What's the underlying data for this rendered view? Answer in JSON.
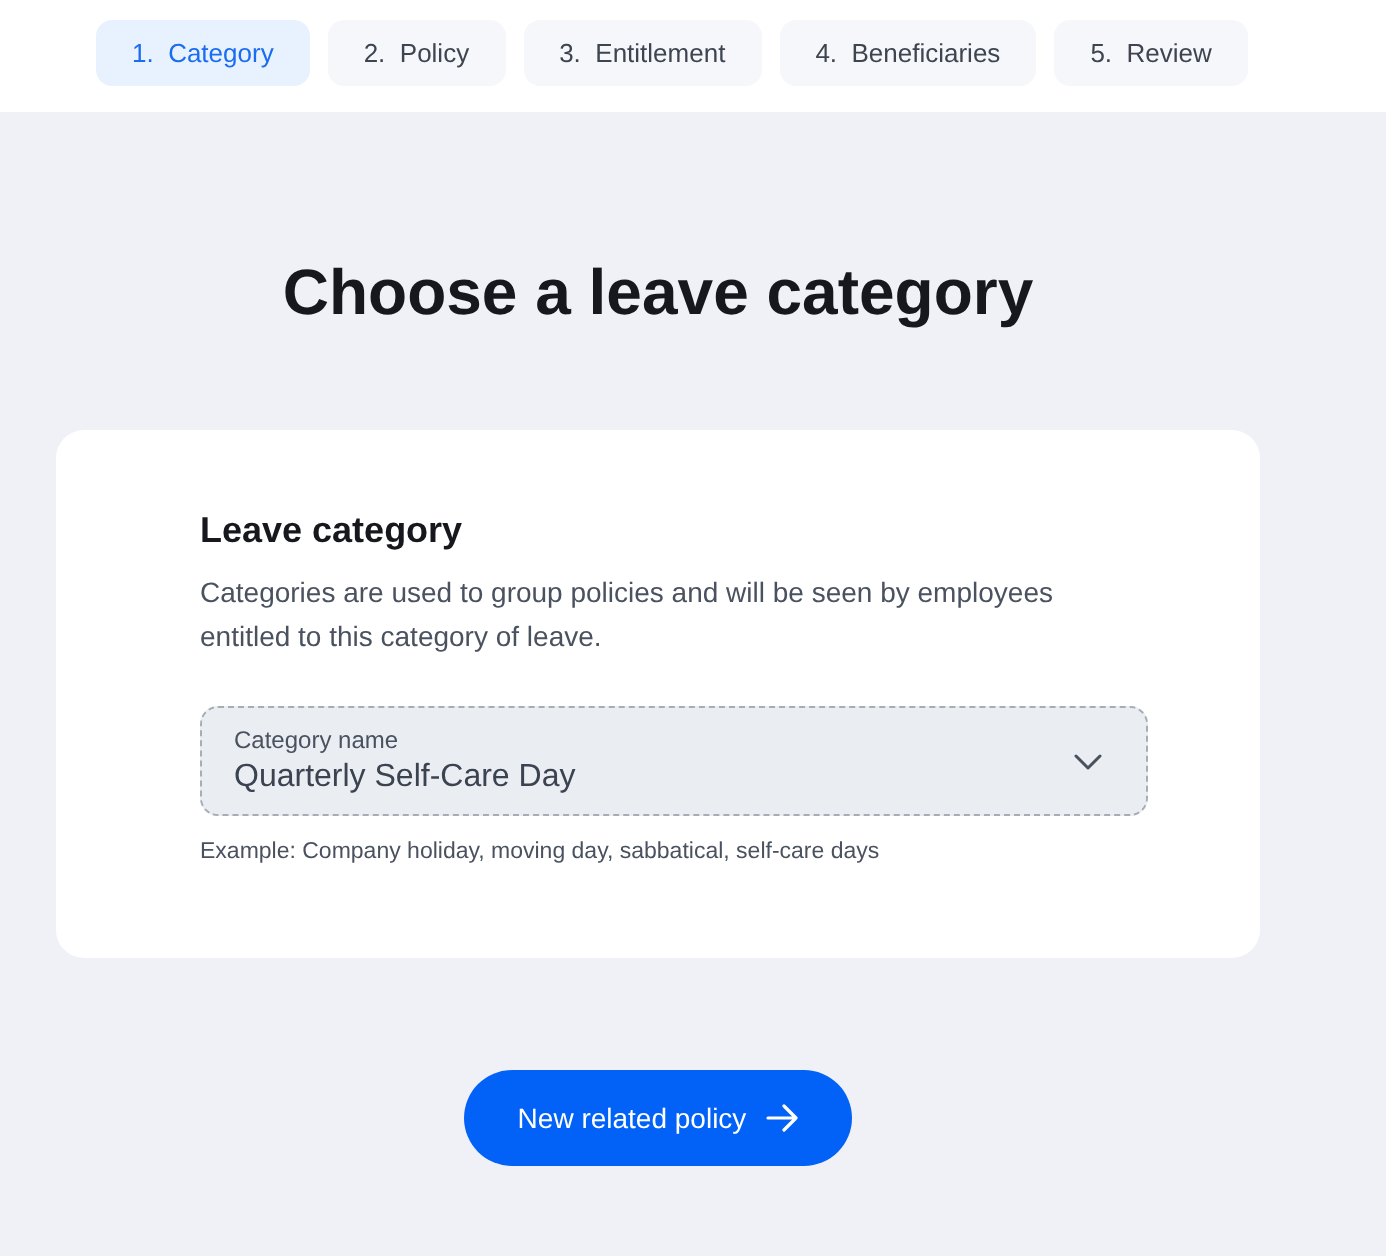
{
  "steps": [
    {
      "number": "1.",
      "label": "Category",
      "selected": true
    },
    {
      "number": "2.",
      "label": "Policy",
      "selected": false
    },
    {
      "number": "3.",
      "label": "Entitlement",
      "selected": false
    },
    {
      "number": "4.",
      "label": "Beneficiaries",
      "selected": false
    },
    {
      "number": "5.",
      "label": "Review",
      "selected": false
    }
  ],
  "heading": "Choose a leave category",
  "card": {
    "title": "Leave category",
    "description": "Categories are used to group policies and will be seen by employees entitled to this category of leave.",
    "select": {
      "label": "Category name",
      "value": "Quarterly Self-Care Day",
      "hint": "Example: Company holiday, moving day, sabbatical, self-care days"
    }
  },
  "button": {
    "label": "New related policy"
  }
}
